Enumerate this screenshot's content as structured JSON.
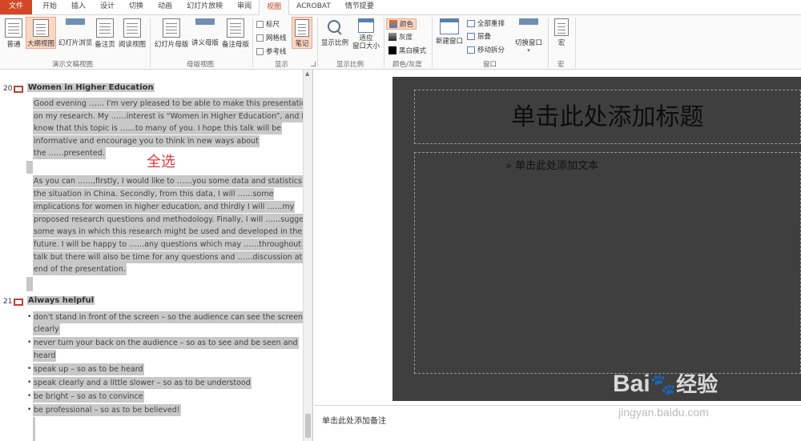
{
  "tabs": [
    {
      "label": "文件"
    },
    {
      "label": "开始"
    },
    {
      "label": "插入"
    },
    {
      "label": "设计"
    },
    {
      "label": "切换"
    },
    {
      "label": "动画"
    },
    {
      "label": "幻灯片放映"
    },
    {
      "label": "审阅"
    },
    {
      "label": "视图"
    },
    {
      "label": "ACROBAT"
    },
    {
      "label": "情节提要"
    }
  ],
  "ribbon": {
    "groups": {
      "presentation_views": "演示文稿视图",
      "master_views": "母版视图",
      "show": "显示",
      "zoom": "显示比例",
      "color": "颜色/灰度",
      "window": "窗口",
      "macros": "宏"
    },
    "buttons": {
      "normal": "普通",
      "outline": "大纲视图",
      "slide_sorter": "幻灯片浏览",
      "notes_page": "备注页",
      "reading_view": "阅读视图",
      "slide_master": "幻灯片母版",
      "handout_master": "讲义母版",
      "notes_master": "备注母版",
      "ruler": "标尺",
      "gridlines": "网格线",
      "guides": "参考线",
      "notes": "笔记",
      "zoom": "显示比例",
      "fit_window_1": "适应",
      "fit_window_2": "窗口大小",
      "color": "颜色",
      "grayscale": "灰度",
      "black_white": "黑白模式",
      "new_window": "新建窗口",
      "arrange_all": "全部重排",
      "cascade": "层叠",
      "move_split": "移动拆分",
      "switch_windows": "切换窗口",
      "macros": "宏"
    }
  },
  "outline": {
    "slide20": {
      "number": "20",
      "title": "Women in Higher Education",
      "para1": [
        "  Good evening …… I'm very pleased to be able to make this presentation",
        "on my research.  My ……interest is “Women in Higher Education”, and I",
        "know that this topic is ……to many of you. I hope this talk will be",
        "informative and encourage you to think in new ways about",
        "the ……presented."
      ],
      "para2": [
        "As you can ……,firstly, I would like to ……you some data and statistics on",
        "the situation in China.  Secondly, from this data, I will ……some",
        "implications for women in higher education, and thirdly I will ……my",
        "proposed research questions and methodology.  Finally, I will ……suggest",
        "some ways in which this research might be used and developed in the",
        "future.  I will be happy to ……any questions which may ……throughout the",
        "talk but there will also be time for any questions and ……discussion at the",
        "end of the presentation."
      ]
    },
    "annotation": "全选",
    "slide21": {
      "number": "21",
      "title": "Always helpful",
      "bullets": [
        [
          "don't stand in front of the screen – so the audience can see the screen",
          "clearly"
        ],
        [
          "never turn your back on the audience – so as to see and be seen and",
          "heard"
        ],
        [
          "speak up – so as to be heard"
        ],
        [
          "speak clearly and a little slower  – so as to be understood"
        ],
        [
          "be bright – so as to convince"
        ],
        [
          "be professional – so as to be believed!"
        ]
      ]
    }
  },
  "slide": {
    "title_placeholder": "单击此处添加标题",
    "body_bullet": "»",
    "body_placeholder": "单击此处添加文本",
    "notes_placeholder": "单击此处添加备注"
  },
  "watermark": {
    "brand": "Bai",
    "brand2": "经验",
    "url": "jingyan.baidu.com"
  },
  "colors": {
    "accent": "#d24726",
    "selection": "#c8c8c8",
    "slide_bg": "#3f3f3f",
    "annotation": "#e23a3a"
  }
}
